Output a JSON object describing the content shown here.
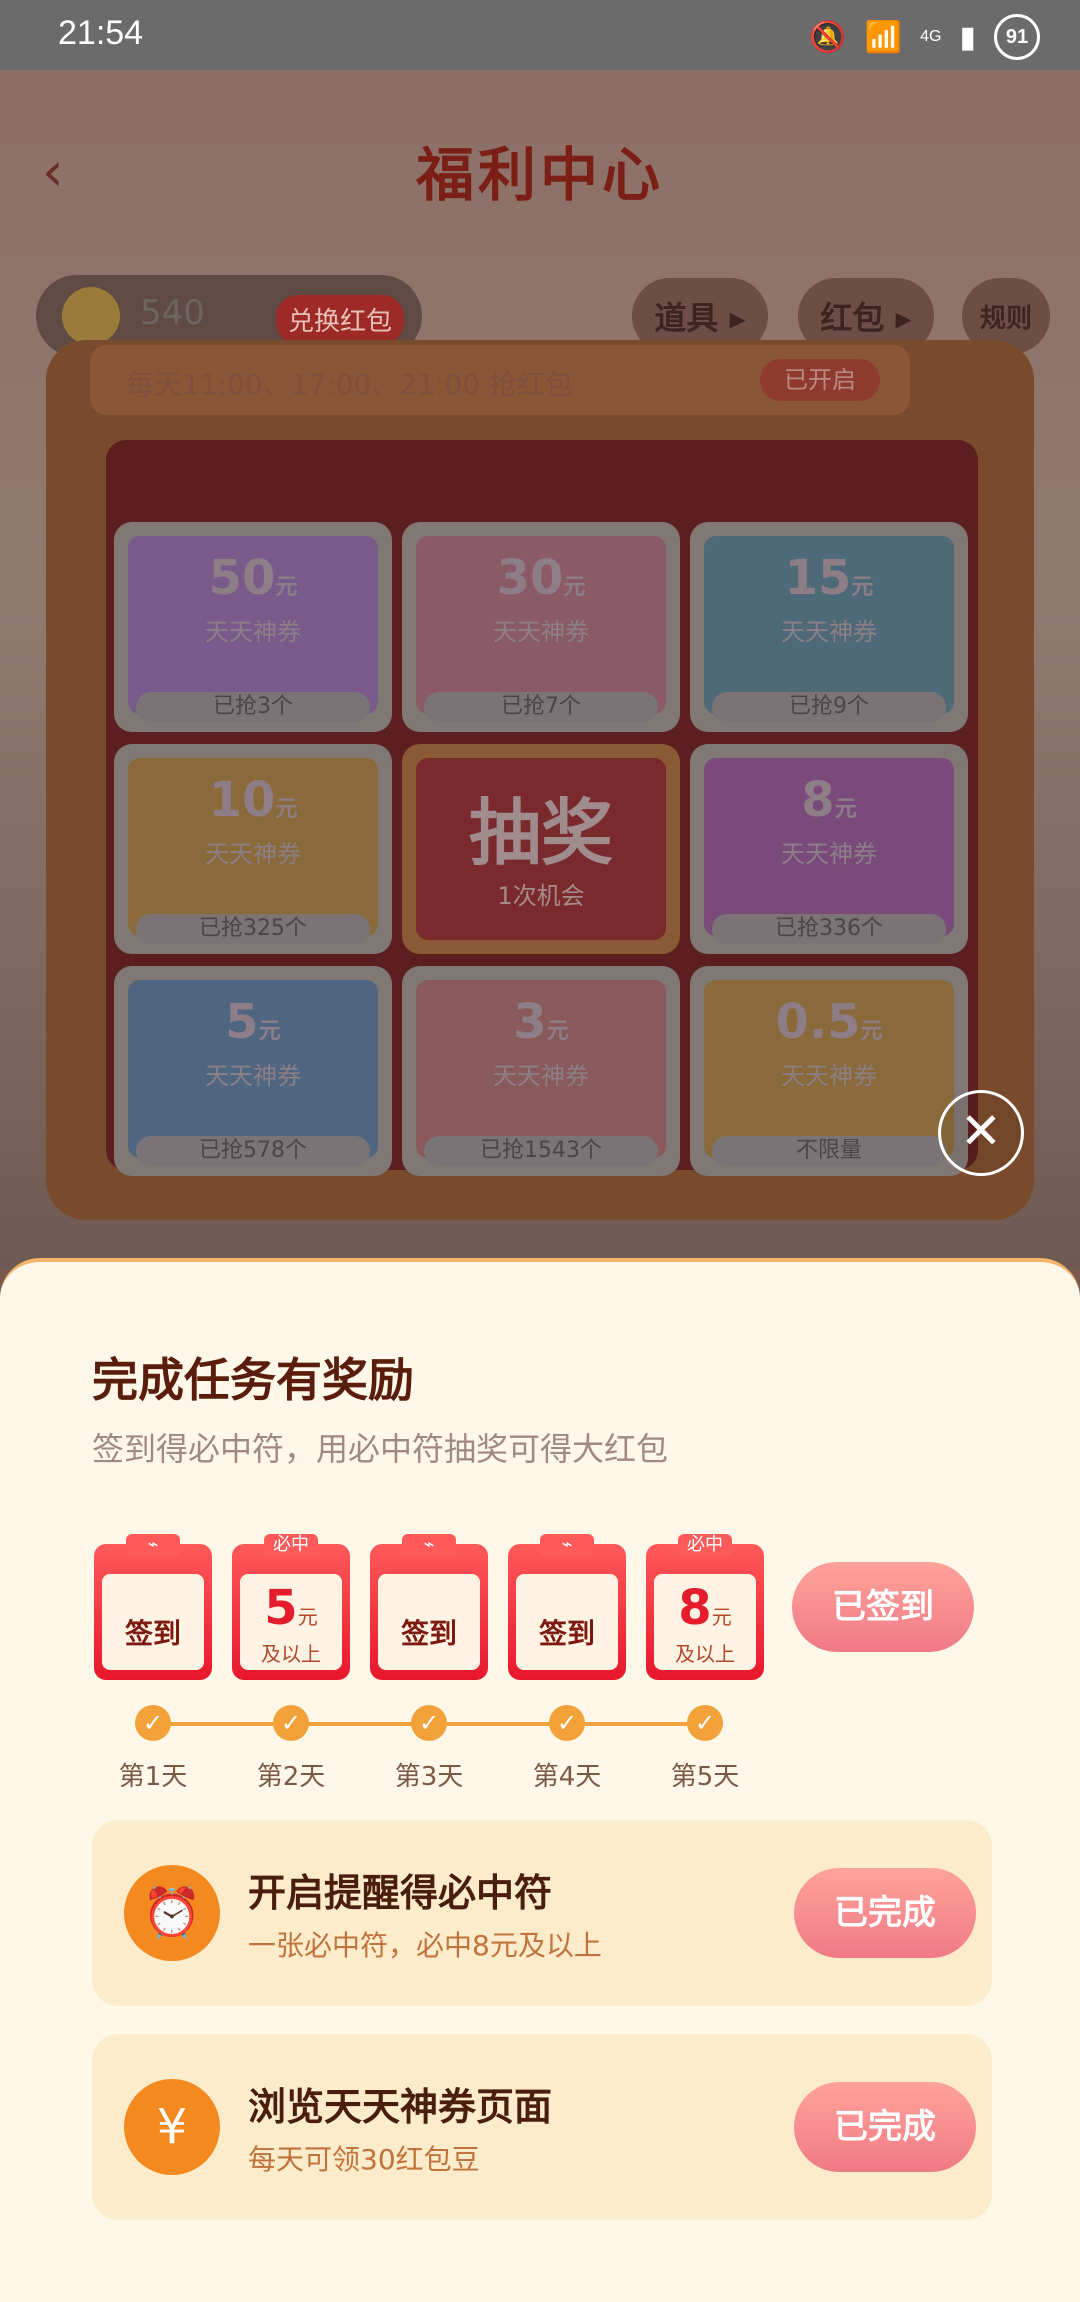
{
  "status": {
    "time": "21:54",
    "battery": "91",
    "network": "4G"
  },
  "header": {
    "title": "福利中心",
    "back": "‹"
  },
  "coins": {
    "amount": "540",
    "exchange_label": "兑换红包"
  },
  "pills": {
    "props": "道具 ▸",
    "redpack": "红包 ▸",
    "rules": "规则"
  },
  "lottery": {
    "schedule": "每天11:00、17:00、21:00 抢红包",
    "toggle": "已开启",
    "cells": [
      {
        "amount": "50",
        "unit": "元",
        "name": "天天神券",
        "grabbed": "已抢3个"
      },
      {
        "amount": "30",
        "unit": "元",
        "name": "天天神券",
        "grabbed": "已抢7个"
      },
      {
        "amount": "15",
        "unit": "元",
        "name": "天天神券",
        "grabbed": "已抢9个"
      },
      {
        "amount": "10",
        "unit": "元",
        "name": "天天神券",
        "grabbed": "已抢325个"
      },
      {
        "amount": "8",
        "unit": "元",
        "name": "天天神券",
        "grabbed": "已抢336个"
      },
      {
        "amount": "5",
        "unit": "元",
        "name": "天天神券",
        "grabbed": "已抢578个"
      },
      {
        "amount": "3",
        "unit": "元",
        "name": "天天神券",
        "grabbed": "已抢1543个"
      },
      {
        "amount": "0.5",
        "unit": "元",
        "name": "天天神券",
        "grabbed": "不限量"
      }
    ],
    "draw": {
      "label": "抽奖",
      "chance": "1次机会"
    }
  },
  "sheet": {
    "title": "完成任务有奖励",
    "subtitle": "签到得必中符，用必中符抽奖可得大红包",
    "days": [
      {
        "type": "sign",
        "label": "签到",
        "day": "第1天"
      },
      {
        "type": "prize",
        "tab": "必中",
        "amount": "5",
        "unit": "元",
        "above": "及以上",
        "day": "第2天"
      },
      {
        "type": "sign",
        "label": "签到",
        "day": "第3天"
      },
      {
        "type": "sign",
        "label": "签到",
        "day": "第4天"
      },
      {
        "type": "prize",
        "tab": "必中",
        "amount": "8",
        "unit": "元",
        "above": "及以上",
        "day": "第5天"
      }
    ],
    "signed_label": "已签到",
    "tasks": [
      {
        "title": "开启提醒得必中符",
        "desc": "一张必中符，必中8元及以上",
        "button": "已完成",
        "icon": "alarm-clock-icon"
      },
      {
        "title": "浏览天天神券页面",
        "desc": "每天可领30红包豆",
        "button": "已完成",
        "icon": "coupon-yen-icon"
      }
    ]
  },
  "close_label": "✕"
}
